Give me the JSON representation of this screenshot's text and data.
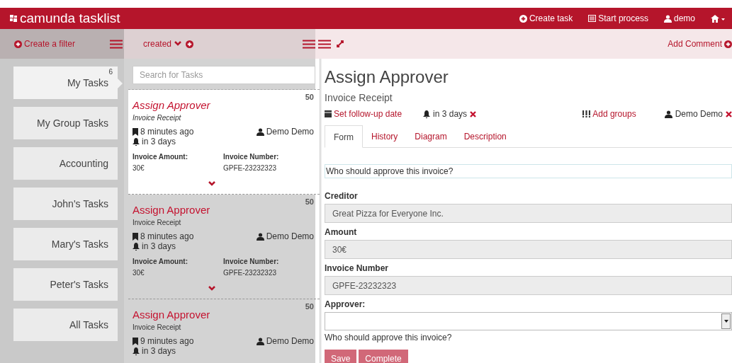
{
  "header": {
    "brand": "camunda tasklist",
    "actions": [
      {
        "kind": "create",
        "label": "Create task"
      },
      {
        "kind": "process",
        "label": "Start process"
      },
      {
        "kind": "user",
        "label": "demo"
      }
    ]
  },
  "filters": {
    "create_label": "Create a filter",
    "items": [
      {
        "name": "My Tasks",
        "count": "6",
        "selected": true
      },
      {
        "name": "My Group Tasks",
        "selected": false
      },
      {
        "name": "Accounting",
        "selected": false
      },
      {
        "name": "John's Tasks",
        "selected": false
      },
      {
        "name": "Mary's Tasks",
        "selected": false
      },
      {
        "name": "Peter's Tasks",
        "selected": false
      },
      {
        "name": "All Tasks",
        "selected": false
      }
    ]
  },
  "list": {
    "sort_label": "created",
    "search": {
      "placeholder": "Search for Tasks"
    },
    "tasks": [
      {
        "name": "Assign Approver",
        "process": "Invoice Receipt",
        "priority": "50",
        "created": "8 minutes ago",
        "assignee": "Demo Demo",
        "due": "in 3 days",
        "variables": [
          {
            "label": "Invoice Amount:",
            "value": "30€"
          },
          {
            "label": "Invoice Number:",
            "value": "GPFE-23232323"
          }
        ],
        "selected": true
      },
      {
        "name": "Assign Approver",
        "process": "Invoice Receipt",
        "priority": "50",
        "created": "8 minutes ago",
        "assignee": "Demo Demo",
        "due": "in 3 days",
        "variables": [
          {
            "label": "Invoice Amount:",
            "value": "30€"
          },
          {
            "label": "Invoice Number:",
            "value": "GPFE-23232323"
          }
        ],
        "selected": false
      },
      {
        "name": "Assign Approver",
        "process": "Invoice Receipt",
        "priority": "50",
        "created": "9 minutes ago",
        "assignee": "Demo Demo",
        "due": "in 3 days",
        "selected": false
      }
    ]
  },
  "task": {
    "add_comment": "Add Comment",
    "title": "Assign Approver",
    "process": "Invoice Receipt",
    "follow_up": "Set follow-up date",
    "due": "in 3 days",
    "groups": "Add groups",
    "assignee": "Demo Demo",
    "tabs": [
      {
        "label": "Form",
        "selected": true
      },
      {
        "label": "History",
        "selected": false
      },
      {
        "label": "Diagram",
        "selected": false
      },
      {
        "label": "Description",
        "selected": false
      }
    ],
    "form": {
      "intro": "Who should approve this invoice?",
      "fields": [
        {
          "kind": "readonly",
          "label": "Creditor",
          "value": "Great Pizza for Everyone Inc."
        },
        {
          "kind": "readonly",
          "label": "Amount",
          "value": "30€"
        },
        {
          "kind": "readonly",
          "label": "Invoice Number",
          "value": "GPFE-23232323"
        },
        {
          "kind": "select",
          "label": "Approver:",
          "help": "Who should approve this invoice?"
        }
      ],
      "buttons": [
        "Save",
        "Complete"
      ]
    }
  }
}
